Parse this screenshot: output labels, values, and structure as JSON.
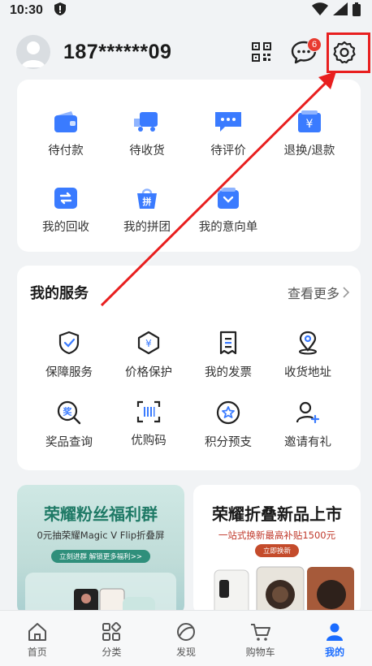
{
  "status_bar": {
    "time": "10:30"
  },
  "header": {
    "username": "187******09",
    "message_badge": "6"
  },
  "orders": [
    {
      "label": "待付款",
      "icon": "wallet-icon"
    },
    {
      "label": "待收货",
      "icon": "truck-icon"
    },
    {
      "label": "待评价",
      "icon": "comment-icon"
    },
    {
      "label": "退换/退款",
      "icon": "refund-icon"
    },
    {
      "label": "我的回收",
      "icon": "recycle-icon"
    },
    {
      "label": "我的拼团",
      "icon": "group-buy-icon"
    },
    {
      "label": "我的意向单",
      "icon": "intent-order-icon"
    }
  ],
  "services": {
    "title": "我的服务",
    "see_more": "查看更多",
    "items": [
      {
        "label": "保障服务",
        "icon": "shield-icon"
      },
      {
        "label": "价格保护",
        "icon": "price-protect-icon"
      },
      {
        "label": "我的发票",
        "icon": "invoice-icon"
      },
      {
        "label": "收货地址",
        "icon": "location-icon"
      },
      {
        "label": "奖品查询",
        "icon": "prize-search-icon"
      },
      {
        "label": "优购码",
        "icon": "barcode-icon"
      },
      {
        "label": "积分预支",
        "icon": "points-icon"
      },
      {
        "label": "邀请有礼",
        "icon": "invite-icon"
      }
    ]
  },
  "promos": [
    {
      "title": "荣耀粉丝福利群",
      "subtitle": "0元抽荣耀Magic V Flip折叠屏",
      "button": "立刻进群 解锁更多福利>>"
    },
    {
      "title": "荣耀折叠新品上市",
      "subtitle": "一站式换新最高补贴1500元",
      "button": "立即换新"
    }
  ],
  "tabs": [
    {
      "label": "首页",
      "icon": "home-icon"
    },
    {
      "label": "分类",
      "icon": "category-icon"
    },
    {
      "label": "发现",
      "icon": "discover-icon"
    },
    {
      "label": "购物车",
      "icon": "cart-icon"
    },
    {
      "label": "我的",
      "icon": "profile-icon",
      "active": true
    }
  ],
  "colors": {
    "accent": "#1a6cff",
    "icon_blue": "#3a7bff",
    "highlight_red": "#e81f1f",
    "promo_green": "#1f7a66"
  }
}
